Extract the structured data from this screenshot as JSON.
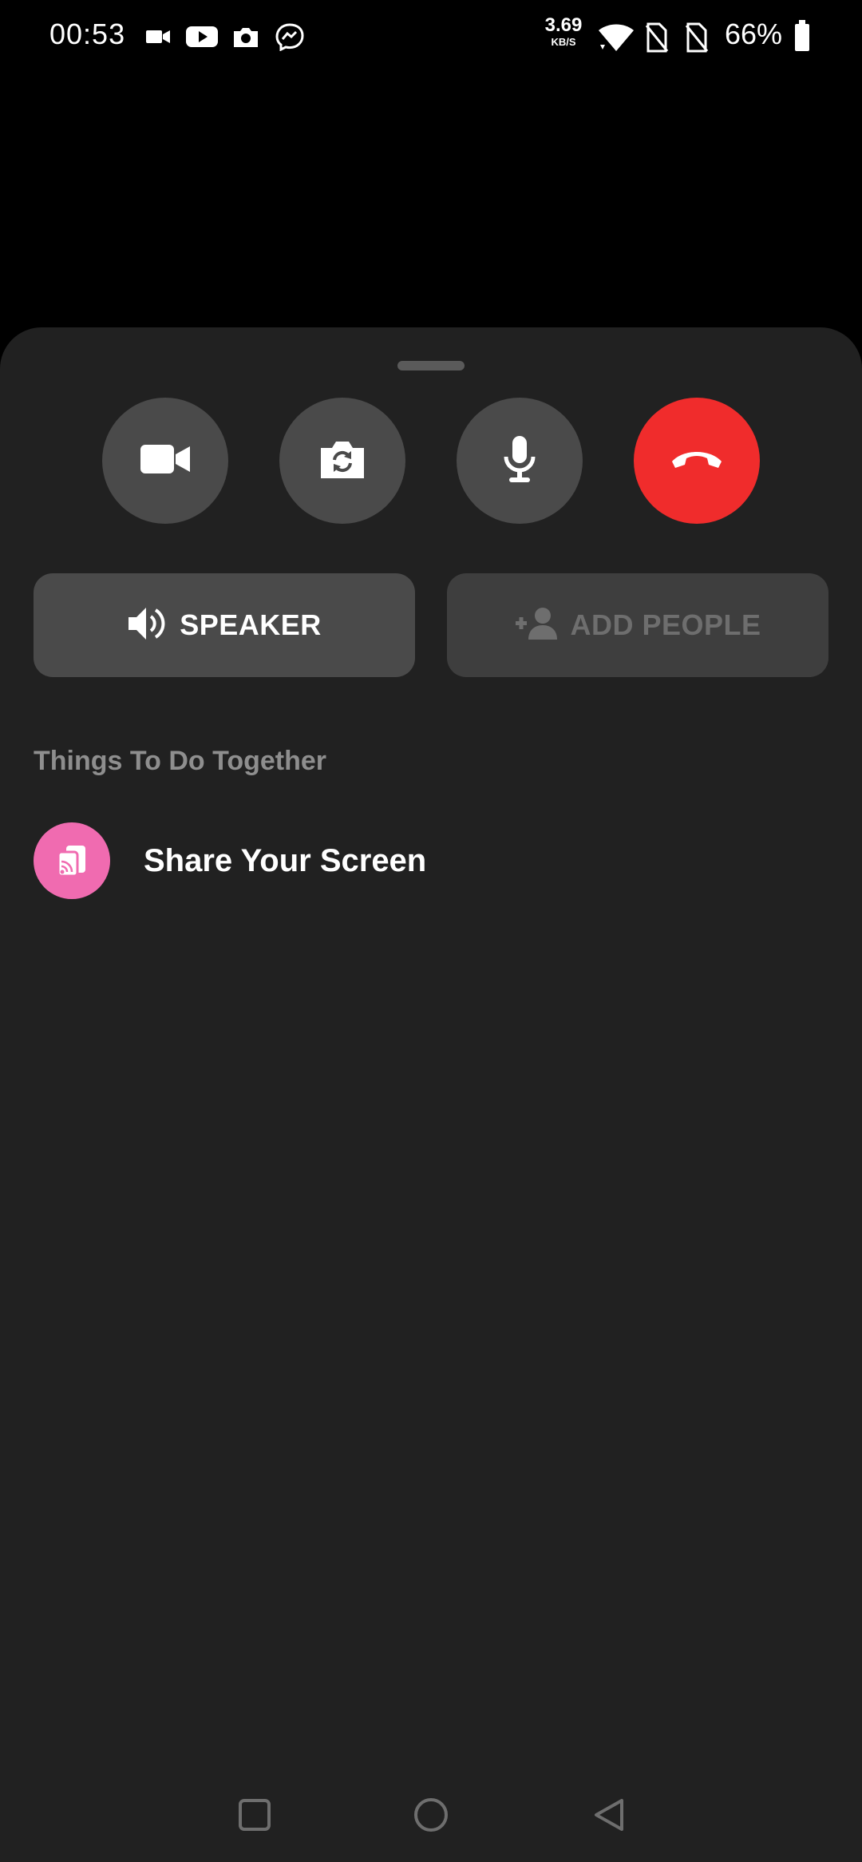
{
  "status_bar": {
    "time": "00:53",
    "net_speed_value": "3.69",
    "net_speed_unit": "KB/S",
    "battery_percent": "66%",
    "notification_icons": [
      "video-camera-icon",
      "youtube-icon",
      "camera-icon",
      "messenger-icon"
    ],
    "system_icons": [
      "wifi-icon",
      "no-sim-icon",
      "no-sim-icon",
      "battery-icon"
    ]
  },
  "call_controls": [
    {
      "name": "video-toggle",
      "icon": "video-camera-icon"
    },
    {
      "name": "flip-camera",
      "icon": "camera-switch-icon"
    },
    {
      "name": "mute",
      "icon": "microphone-icon"
    },
    {
      "name": "end-call",
      "icon": "hang-up-icon"
    }
  ],
  "actions": {
    "speaker_label": "SPEAKER",
    "add_people_label": "ADD PEOPLE"
  },
  "section": {
    "title": "Things To Do Together"
  },
  "activities": [
    {
      "label": "Share Your Screen",
      "icon": "screen-share-icon"
    }
  ],
  "colors": {
    "sheet_bg": "#212121",
    "button_bg": "#4a4a4a",
    "end_call": "#f02c2c",
    "share_accent": "#f06bb0"
  },
  "nav_bar": [
    "recents-button",
    "home-button",
    "back-button"
  ]
}
